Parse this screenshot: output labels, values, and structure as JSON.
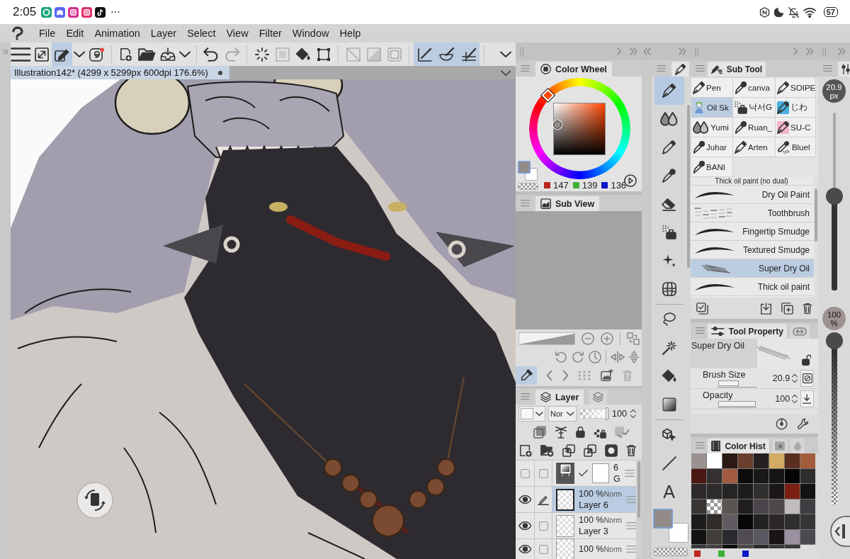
{
  "status_bar": {
    "time": "2:05",
    "more": "⋯",
    "battery": "57"
  },
  "menu_bar": {
    "items": [
      "File",
      "Edit",
      "Animation",
      "Layer",
      "Select",
      "View",
      "Filter",
      "Window",
      "Help"
    ]
  },
  "toolbar": {
    "groups": [
      [
        {
          "kind": "menu",
          "selected": false,
          "disabled": false
        },
        {
          "kind": "expand",
          "selected": false,
          "disabled": false
        },
        {
          "kind": "edit",
          "selected": true,
          "disabled": false
        },
        {
          "kind": "dropdown",
          "selected": false,
          "disabled": false
        },
        {
          "kind": "spiral",
          "selected": false,
          "disabled": false
        }
      ],
      [
        {
          "kind": "new",
          "selected": false,
          "disabled": false
        },
        {
          "kind": "open",
          "selected": false,
          "disabled": false
        },
        {
          "kind": "export",
          "selected": false,
          "disabled": false
        },
        {
          "kind": "dropdown",
          "selected": false,
          "disabled": false
        }
      ],
      [
        {
          "kind": "undo",
          "selected": false,
          "disabled": false
        },
        {
          "kind": "redo",
          "selected": false,
          "disabled": true
        }
      ],
      [
        {
          "kind": "select",
          "selected": false,
          "disabled": false
        },
        {
          "kind": "deselect",
          "selected": false,
          "disabled": true
        },
        {
          "kind": "fill",
          "selected": false,
          "disabled": false
        },
        {
          "kind": "transform",
          "selected": false,
          "disabled": false
        }
      ],
      [
        {
          "kind": "invert",
          "selected": false,
          "disabled": true
        },
        {
          "kind": "shade",
          "selected": false,
          "disabled": true
        },
        {
          "kind": "border",
          "selected": false,
          "disabled": true
        }
      ],
      [
        {
          "kind": "ruler",
          "selected": true,
          "disabled": false
        },
        {
          "kind": "curve",
          "selected": true,
          "disabled": false
        },
        {
          "kind": "grid",
          "selected": true,
          "disabled": false
        }
      ],
      [
        {
          "kind": "dropdown",
          "selected": false,
          "disabled": false
        }
      ]
    ]
  },
  "document": {
    "title": "Illustration142* (4299 x 5299px 600dpi 176.6%)",
    "modified": true
  },
  "color_wheel": {
    "title": "Color Wheel",
    "swatches": [
      {
        "color": "#938b88",
        "selected": true
      },
      {
        "color": "#ffffff",
        "selected": false
      }
    ],
    "channels": [
      {
        "value": "147",
        "color": "#b8281c"
      },
      {
        "value": "139",
        "color": "#3cb034"
      },
      {
        "value": "136",
        "color": "#0a14c8"
      }
    ]
  },
  "sub_view": {
    "title": "Sub View"
  },
  "navigator": {
    "zoom_slider": {
      "level": 1
    },
    "eyedropper": {
      "selected": true
    }
  },
  "layer_panel": {
    "title": "Layer",
    "blend_mode": "Nor",
    "opacity": {
      "value": "100",
      "level": 1
    },
    "layers": [
      {
        "kind": "gradient",
        "visible": false,
        "editing": false,
        "selected": false,
        "opacity": "6",
        "name": "G"
      },
      {
        "kind": "raster",
        "visible": true,
        "editing": true,
        "selected": true,
        "opacity": "100 %",
        "blend": "Norm",
        "name": "Layer 6"
      },
      {
        "kind": "raster",
        "visible": true,
        "editing": false,
        "selected": false,
        "opacity": "100 %",
        "blend": "Norm",
        "name": "Layer 3"
      },
      {
        "kind": "raster",
        "visible": true,
        "editing": false,
        "selected": false,
        "opacity": "100 %",
        "blend": "Norm"
      }
    ]
  },
  "tools": {
    "groups": [
      [
        {
          "kind": "pen",
          "selected": true
        },
        {
          "kind": "blend",
          "selected": false
        },
        {
          "kind": "pencil",
          "selected": false
        },
        {
          "kind": "marker",
          "selected": false
        },
        {
          "kind": "eraser",
          "selected": false
        },
        {
          "kind": "airbrush",
          "selected": false
        },
        {
          "kind": "decoration",
          "selected": false
        },
        {
          "kind": "figure",
          "selected": false
        }
      ],
      [
        {
          "kind": "lasso",
          "selected": false
        },
        {
          "kind": "wand",
          "selected": false
        },
        {
          "kind": "fill",
          "selected": false
        },
        {
          "kind": "gradient",
          "selected": false
        }
      ],
      [
        {
          "kind": "object",
          "selected": false
        },
        {
          "kind": "line",
          "selected": false
        },
        {
          "kind": "text",
          "selected": false,
          "label": "A"
        }
      ]
    ],
    "swatches": [
      {
        "color": "#938b88",
        "selected": true
      },
      {
        "color": "#ffffff",
        "selected": false
      }
    ]
  },
  "sub_tool": {
    "title": "Sub Tool",
    "groups": [
      {
        "name": "Pen",
        "kind": "nib",
        "selected": false
      },
      {
        "name": "canva",
        "kind": "roundpen",
        "selected": false
      },
      {
        "name": "SOIPE",
        "kind": "nib",
        "selected": false
      },
      {
        "name": "Oil Sk",
        "kind": "thumbnail",
        "selected": true
      },
      {
        "name": "낙서G",
        "kind": "airbrush",
        "selected": false
      },
      {
        "name": "じわ",
        "kind": "nib",
        "selected": false,
        "color": "#4ab0e0"
      },
      {
        "name": "Yumi",
        "kind": "drops",
        "selected": false
      },
      {
        "name": "Ruan_",
        "kind": "roundpen",
        "selected": false
      },
      {
        "name": "SU-C",
        "kind": "nib",
        "selected": false,
        "color": "#f6b6c8"
      },
      {
        "name": "Juhar",
        "kind": "roundpen",
        "selected": false
      },
      {
        "name": "Arten",
        "kind": "nib",
        "selected": false
      },
      {
        "name": "Bluel",
        "kind": "dotbrush",
        "selected": false
      },
      {
        "name": "BANI",
        "kind": "roundpen",
        "selected": false
      }
    ],
    "brushes": [
      {
        "name": "Thick oil paint (no dual)",
        "selected": false
      },
      {
        "name": "Dry Oil Paint",
        "kind": "stroke",
        "selected": false
      },
      {
        "name": "Toothbrush",
        "kind": "speckle",
        "selected": false
      },
      {
        "name": "Fingertip Smudge",
        "kind": "stroke",
        "selected": false
      },
      {
        "name": "Textured Smudge",
        "kind": "stroke",
        "selected": false
      },
      {
        "name": "Super Dry Oil",
        "kind": "dry",
        "selected": true
      },
      {
        "name": "Thick oil paint",
        "kind": "stroke",
        "selected": false
      }
    ]
  },
  "tool_property": {
    "title": "Tool Property",
    "brush": "Super Dry Oil",
    "locked": false,
    "properties": [
      {
        "label": "Brush Size",
        "value": "20.9",
        "level": 0.54,
        "kind": "size"
      },
      {
        "label": "Opacity",
        "value": "100",
        "level": 1,
        "kind": "opacity"
      }
    ]
  },
  "color_history": {
    "title": "Color Hist",
    "swatches": [
      {
        "kind": "color",
        "color": "#9a9290"
      },
      {
        "kind": "color",
        "color": "#ffffff"
      },
      {
        "kind": "color",
        "color": "#2b1a14"
      },
      {
        "kind": "color",
        "color": "#6b3f2d"
      },
      {
        "kind": "color",
        "color": "#242120"
      },
      {
        "kind": "color",
        "color": "#d2aa62"
      },
      {
        "kind": "color",
        "color": "#5b2f1f"
      },
      {
        "kind": "color",
        "color": "#a35c3c"
      },
      {
        "kind": "color",
        "color": "#4b1713"
      },
      {
        "kind": "color",
        "color": "#34302f"
      },
      {
        "kind": "color",
        "color": "#a25b41"
      },
      {
        "kind": "color",
        "color": "#0d0b0b"
      },
      {
        "kind": "color",
        "color": "#1b1917"
      },
      {
        "kind": "color",
        "color": "#161513"
      },
      {
        "kind": "color",
        "color": "#060505"
      },
      {
        "kind": "color",
        "color": "#2f2d2d"
      },
      {
        "kind": "color",
        "color": "#2d292d"
      },
      {
        "kind": "color",
        "color": "#2f2d2b"
      },
      {
        "kind": "color",
        "color": "#272523"
      },
      {
        "kind": "color",
        "color": "#1d1b1b"
      },
      {
        "kind": "color",
        "color": "#312f2d"
      },
      {
        "kind": "color",
        "color": "#1b1717"
      },
      {
        "kind": "color",
        "color": "#7b1f13"
      },
      {
        "kind": "color",
        "color": "#131211"
      },
      {
        "kind": "color",
        "color": "#393533"
      },
      {
        "kind": "transparent"
      },
      {
        "kind": "color",
        "color": "#5b5551"
      },
      {
        "kind": "color",
        "color": "#1f1d1d"
      },
      {
        "kind": "color",
        "color": "#49454b"
      },
      {
        "kind": "color",
        "color": "#4d4949"
      },
      {
        "kind": "color",
        "color": "#c1bdbd"
      },
      {
        "kind": "color",
        "color": "#3f3d41"
      },
      {
        "kind": "color",
        "color": "#1d1b1b"
      },
      {
        "kind": "color",
        "color": "#2f2b29"
      },
      {
        "kind": "color",
        "color": "#5f5b61"
      },
      {
        "kind": "color",
        "color": "#080707"
      },
      {
        "kind": "color",
        "color": "#232121"
      },
      {
        "kind": "color",
        "color": "#2b2729"
      },
      {
        "kind": "color",
        "color": "#2f2d2d"
      },
      {
        "kind": "color",
        "color": "#373537"
      },
      {
        "kind": "color",
        "color": "#131313"
      },
      {
        "kind": "color",
        "color": "#413d39"
      },
      {
        "kind": "color",
        "color": "#2b292d"
      },
      {
        "kind": "color",
        "color": "#4f4b51"
      },
      {
        "kind": "color",
        "color": "#5b5761"
      },
      {
        "kind": "color",
        "color": "#171317"
      },
      {
        "kind": "color",
        "color": "#9b91a1"
      },
      {
        "kind": "color",
        "color": "#4d4951"
      },
      {
        "kind": "color",
        "color": "#3b3939"
      },
      {
        "kind": "color",
        "color": "#454141"
      },
      {
        "kind": "color",
        "color": "#090909"
      },
      {
        "kind": "color",
        "color": "#4b4749"
      },
      {
        "kind": "color",
        "color": "#2b2929"
      },
      {
        "kind": "color",
        "color": "#393737"
      },
      {
        "kind": "color",
        "color": "#3b3939"
      },
      {
        "kind": "color",
        "color": "#e1ddd9"
      }
    ],
    "channels": [
      {
        "color": "#c0281c"
      },
      {
        "color": "#3cb034"
      },
      {
        "color": "#0a18c8"
      }
    ]
  },
  "side_sliders": {
    "brush_size": {
      "value": "20.9",
      "unit": "px",
      "level": 0.53
    },
    "opacity": {
      "value": "100",
      "unit": "%",
      "level": 1
    }
  }
}
